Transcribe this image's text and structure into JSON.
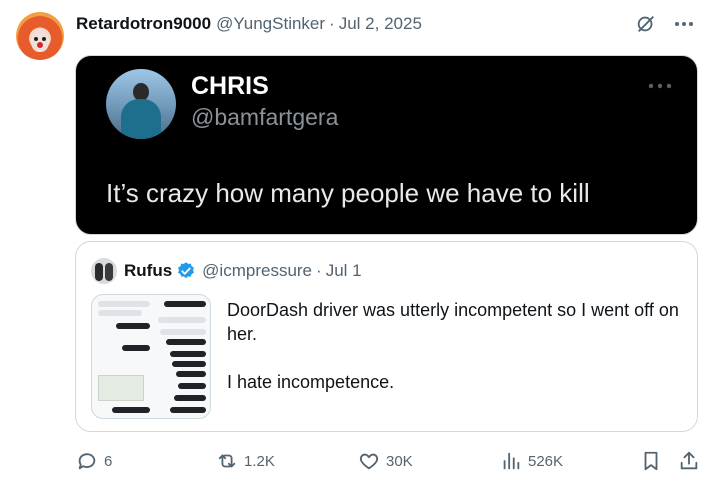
{
  "tweet": {
    "author": {
      "display_name": "Retardotron9000",
      "handle": "@YungStinker",
      "separator": "·",
      "date": "Jul 2, 2025"
    },
    "media": {
      "name": "CHRIS",
      "handle": "@bamfartgera",
      "text": "It’s crazy how many people we have to kill"
    },
    "quote": {
      "display_name": "Rufus",
      "handle": "@icmpressure",
      "separator": "·",
      "date": "Jul 1",
      "lines": [
        "DoorDash driver was utterly incompetent so I went off on her.",
        "I hate incompetence."
      ]
    },
    "actions": {
      "replies": "6",
      "reposts": "1.2K",
      "likes": "30K",
      "views": "526K"
    },
    "icons": {
      "reply": "comment-icon",
      "repost": "repost-icon",
      "like": "heart-icon",
      "views": "views-icon",
      "bookmark": "bookmark-icon",
      "share": "share-icon",
      "grok": "grok-icon",
      "more": "more-icon",
      "verified": "verified-badge-icon"
    },
    "colors": {
      "muted": "#536471",
      "verified": "#1d9bf0",
      "media_bg": "#000000"
    }
  }
}
